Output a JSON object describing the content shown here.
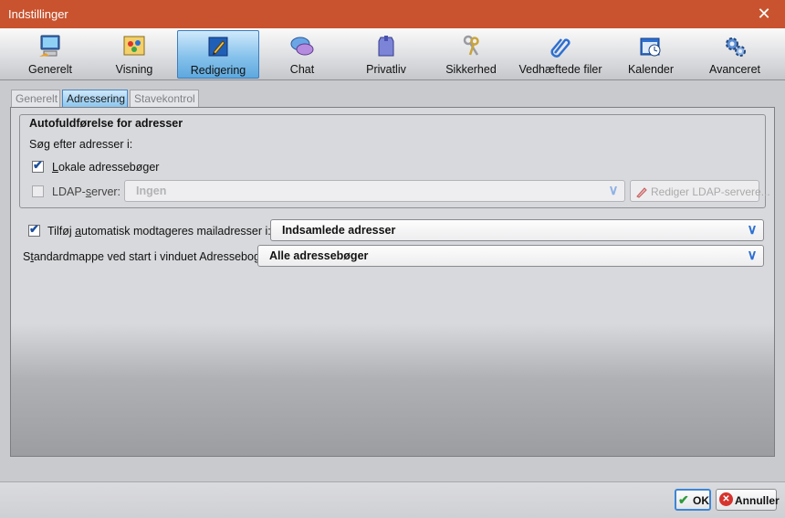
{
  "window": {
    "title": "Indstillinger"
  },
  "toolbar": {
    "items": [
      {
        "label": "Generelt",
        "icon": "monitor-icon"
      },
      {
        "label": "Visning",
        "icon": "palette-icon"
      },
      {
        "label": "Redigering",
        "icon": "pen-icon",
        "active": true
      },
      {
        "label": "Chat",
        "icon": "chat-bubbles-icon"
      },
      {
        "label": "Privatliv",
        "icon": "shield-box-icon"
      },
      {
        "label": "Sikkerhed",
        "icon": "keys-icon"
      },
      {
        "label": "Vedhæftede filer",
        "icon": "paperclip-icon"
      },
      {
        "label": "Kalender",
        "icon": "calendar-clock-icon"
      },
      {
        "label": "Avanceret",
        "icon": "gears-icon"
      }
    ]
  },
  "subtabs": [
    {
      "label": "Generelt"
    },
    {
      "label": "Adressering",
      "active": true
    },
    {
      "label": "Stavekontrol"
    }
  ],
  "autocomplete": {
    "title": "Autofuldførelse for adresser",
    "search_label": "Søg efter adresser i:",
    "local": {
      "label_u": "L",
      "label_rest": "okale adressebøger",
      "checked": true
    },
    "ldap": {
      "label_pre": "LDAP-",
      "label_u": "s",
      "label_post": "erver:",
      "checked": false,
      "value": "Ingen",
      "edit_button": "Rediger LDAP-servere..."
    }
  },
  "auto_add": {
    "label_pre": "Tilføj ",
    "label_u": "a",
    "label_post": "utomatisk modtageres mailadresser i:",
    "checked": true,
    "value": "Indsamlede adresser"
  },
  "default_folder": {
    "label_pre": "S",
    "label_u": "t",
    "label_post": "andardmappe ved start i vinduet Adressebog:",
    "value": "Alle adressebøger"
  },
  "footer": {
    "ok": "OK",
    "cancel": "Annuller"
  },
  "colors": {
    "titlebar": "#c8532e",
    "active_tab": "#86c2ec",
    "accent": "#2d6fd2"
  }
}
